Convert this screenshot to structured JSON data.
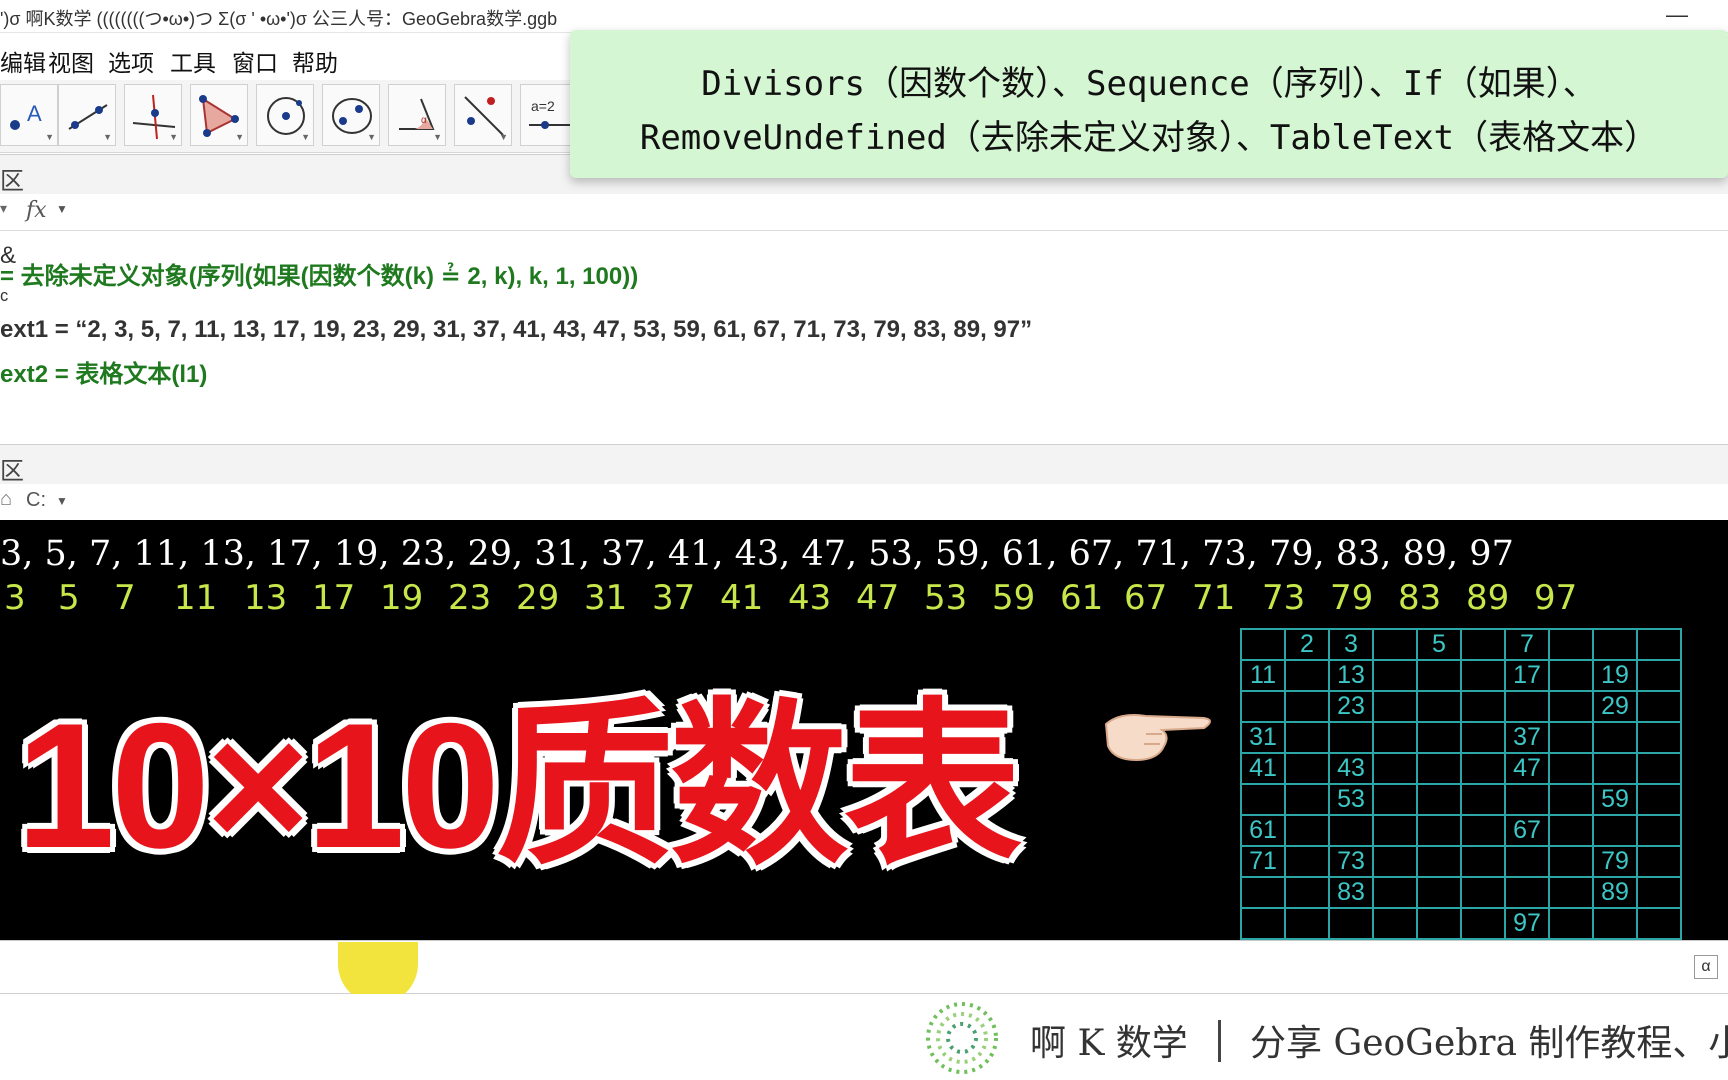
{
  "window": {
    "title": "')σ 啊K数学   ((((((((つ•ω•)つ Σ(σ ' •ω•')σ 公三人号：GeoGebra数学.ggb",
    "minimize": "—"
  },
  "menu": [
    "编辑",
    "视图",
    "选项",
    "工具",
    "窗口",
    "帮助"
  ],
  "toolbar": {
    "tools": [
      "move-tool",
      "line-tool",
      "perpendicular-tool",
      "polygon-tool",
      "circle-tool",
      "conic-tool",
      "angle-tool",
      "reflect-tool",
      "slider-tool"
    ],
    "slider_label": "a=2"
  },
  "banner": {
    "line1": "Divisors（因数个数）、Sequence（序列）、If（如果）、",
    "line2": "RemoveUndefined（去除未定义对象）、TableText（表格文本）"
  },
  "algebra": {
    "header": "区",
    "fx_label": "fx",
    "rows": [
      {
        "text": "& ",
        "style": "dark"
      },
      {
        "text": " = 去除未定义对象(序列(如果(因数个数(k) ≟ 2, k), k, 1, 100))",
        "style": "green"
      },
      {
        "text": "ᶜ",
        "style": "dark"
      },
      {
        "text": "ext1 = “2, 3, 5, 7, 11, 13, 17, 19, 23, 29, 31, 37, 41, 43, 47, 53, 59, 61, 67, 71, 73, 79, 83, 89, 97”",
        "style": "dark"
      },
      {
        "text": "ext2 = 表格文本(l1)",
        "style": "green"
      }
    ]
  },
  "graphics": {
    "header": "区",
    "home_label": "⌂",
    "dropdown_label": "C:",
    "serif_list": "3, 5, 7, 11, 13, 17, 19, 23, 29, 31, 37, 41, 43, 47, 53, 59, 61, 67, 71, 73, 79, 83, 89, 97",
    "primes_row": [
      "3",
      "5",
      "7",
      "11",
      "13",
      "17",
      "19",
      "23",
      "29",
      "31",
      "37",
      "41",
      "43",
      "47",
      "53",
      "59",
      "61",
      "67",
      "71",
      "73",
      "79",
      "83",
      "89",
      "97"
    ],
    "big_title": "10×10质数表",
    "grid": [
      [
        "",
        "2",
        "3",
        "",
        "5",
        "",
        "7",
        "",
        "",
        ""
      ],
      [
        "11",
        "",
        "13",
        "",
        "",
        "",
        "17",
        "",
        "19",
        ""
      ],
      [
        "",
        "",
        "23",
        "",
        "",
        "",
        "",
        "",
        "29",
        ""
      ],
      [
        "31",
        "",
        "",
        "",
        "",
        "",
        "37",
        "",
        "",
        ""
      ],
      [
        "41",
        "",
        "43",
        "",
        "",
        "",
        "47",
        "",
        "",
        ""
      ],
      [
        "",
        "",
        "53",
        "",
        "",
        "",
        "",
        "",
        "59",
        ""
      ],
      [
        "61",
        "",
        "",
        "",
        "",
        "",
        "67",
        "",
        "",
        ""
      ],
      [
        "71",
        "",
        "73",
        "",
        "",
        "",
        "",
        "",
        "79",
        ""
      ],
      [
        "",
        "",
        "83",
        "",
        "",
        "",
        "",
        "",
        "89",
        ""
      ],
      [
        "",
        "",
        "",
        "",
        "",
        "",
        "97",
        "",
        "",
        ""
      ]
    ]
  },
  "input_bar": {
    "alpha_button": "α"
  },
  "footer": {
    "brand": "啊 K 数学",
    "slogan": "分享 GeoGebra 制作教程、小"
  },
  "colors": {
    "accent_green": "#1f7a1f",
    "banner_bg": "#d5f6d3",
    "prime_yellow": "#c6e64a",
    "grid_cyan": "#2aa6a6",
    "title_red": "#e8141c"
  }
}
